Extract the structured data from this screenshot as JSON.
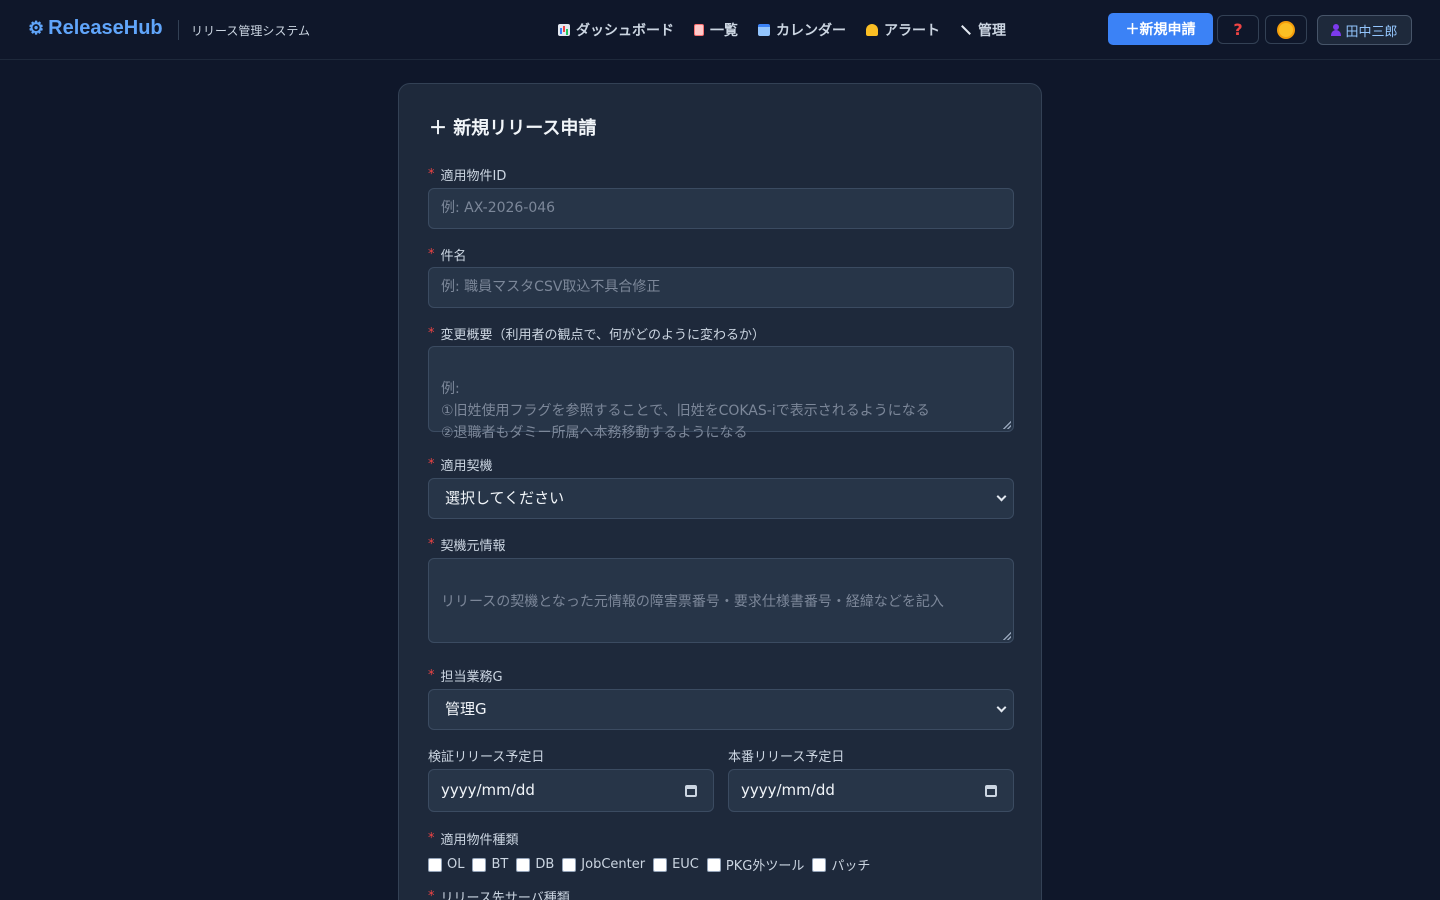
{
  "header": {
    "brand_icon": "gear-icon",
    "brand": "ReleaseHub",
    "subtitle": "リリース管理システム",
    "nav": [
      {
        "label": "ダッシュボード",
        "icon": "chart-icon"
      },
      {
        "label": "一覧",
        "icon": "list-icon"
      },
      {
        "label": "カレンダー",
        "icon": "calendar-icon"
      },
      {
        "label": "アラート",
        "icon": "bell-icon"
      },
      {
        "label": "管理",
        "icon": "wrench-icon"
      }
    ],
    "new_button": "＋新規申請",
    "help": "?",
    "user": "田中三郎",
    "accent": "#3b82f6"
  },
  "form": {
    "title": "＋ 新規リリース申請",
    "fields": {
      "property_id": {
        "label": "適用物件ID",
        "placeholder": "例: AX-2026-046"
      },
      "subject": {
        "label": "件名",
        "placeholder": "例: 職員マスタCSV取込不具合修正"
      },
      "summary": {
        "label": "変更概要（利用者の観点で、何がどのように変わるか）",
        "placeholder": "例:\n①旧姓使用フラグを参照することで、旧姓をCOKAS-iで表示されるようになる\n②退職者もダミー所属へ本務移動するようになる"
      },
      "trigger": {
        "label": "適用契機",
        "value": "選択してください"
      },
      "trigger_info": {
        "label": "契機元情報",
        "placeholder": "リリースの契機となった元情報の障害票番号・要求仕様書番号・経緯などを記入"
      },
      "business_group": {
        "label": "担当業務G",
        "value": "管理G"
      },
      "verify_date": {
        "label": "検証リリース予定日",
        "value": "yyyy/mm/dd"
      },
      "prod_date": {
        "label": "本番リリース予定日",
        "value": "yyyy/mm/dd"
      },
      "property_type": {
        "label": "適用物件種類",
        "options": [
          "OL",
          "BT",
          "DB",
          "JobCenter",
          "EUC",
          "PKG外ツール",
          "パッチ"
        ]
      },
      "server_type": {
        "label": "リリース先サーバ種類"
      }
    }
  }
}
